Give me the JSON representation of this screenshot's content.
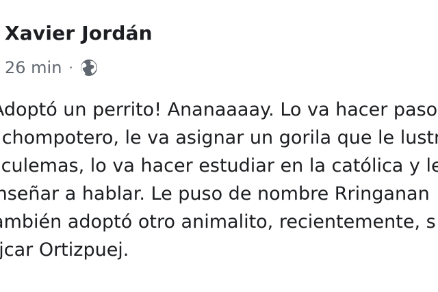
{
  "post": {
    "author": "Xavier Jordán",
    "time": "26 min",
    "separator": "·",
    "audience_icon": "globe-icon",
    "lines": [
      "¡Adoptó un perrito! Ananaaaay. Lo va hacer paso",
      "n chompotero, le va asignar un gorila que le lustre",
      "uiculemas, lo va hacer estudiar en la católica y le",
      "enseñar a hablar. Le puso de nombre Rringanan",
      "También adoptó otro animalito, recientemente, s",
      "Ojcar Ortizpuej."
    ]
  },
  "colors": {
    "text": "#1c1e21",
    "meta": "#606770",
    "background": "#ffffff"
  }
}
